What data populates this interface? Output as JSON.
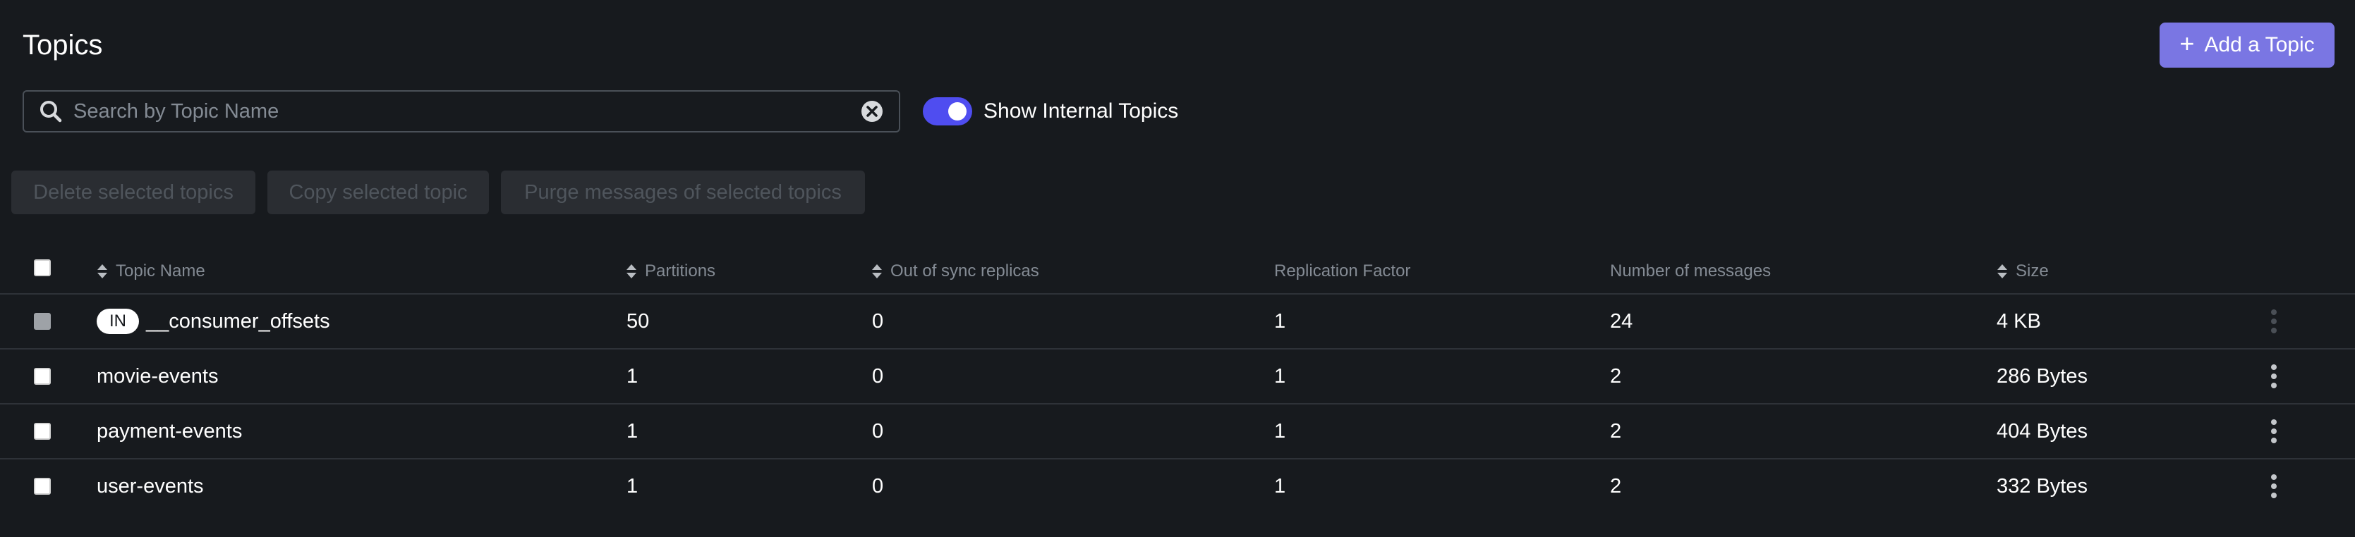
{
  "header": {
    "title": "Topics",
    "add_button_label": "Add a Topic"
  },
  "search": {
    "placeholder": "Search by Topic Name",
    "value": ""
  },
  "toggle": {
    "label": "Show Internal Topics",
    "checked": true
  },
  "bulk_actions": {
    "delete_label": "Delete selected topics",
    "copy_label": "Copy selected topic",
    "purge_label": "Purge messages of selected topics"
  },
  "table": {
    "columns": {
      "topic_name": "Topic Name",
      "partitions": "Partitions",
      "out_of_sync": "Out of sync replicas",
      "replication_factor": "Replication Factor",
      "messages": "Number of messages",
      "size": "Size"
    },
    "rows": [
      {
        "badge": "IN",
        "name": "__consumer_offsets",
        "partitions": "50",
        "out_of_sync": "0",
        "replication_factor": "1",
        "messages": "24",
        "size": "4 KB"
      },
      {
        "badge": "",
        "name": "movie-events",
        "partitions": "1",
        "out_of_sync": "0",
        "replication_factor": "1",
        "messages": "2",
        "size": "286 Bytes"
      },
      {
        "badge": "",
        "name": "payment-events",
        "partitions": "1",
        "out_of_sync": "0",
        "replication_factor": "1",
        "messages": "2",
        "size": "404 Bytes"
      },
      {
        "badge": "",
        "name": "user-events",
        "partitions": "1",
        "out_of_sync": "0",
        "replication_factor": "1",
        "messages": "2",
        "size": "332 Bytes"
      }
    ]
  },
  "colors": {
    "background": "#171a1e",
    "accent": "#7a76e3",
    "toggle_on": "#4f4df0",
    "muted_text": "#848b94"
  },
  "icons": {
    "search": "search-icon",
    "clear": "clear-icon",
    "plus": "plus-icon",
    "sort": "sort-icon",
    "kebab": "kebab-menu-icon"
  }
}
